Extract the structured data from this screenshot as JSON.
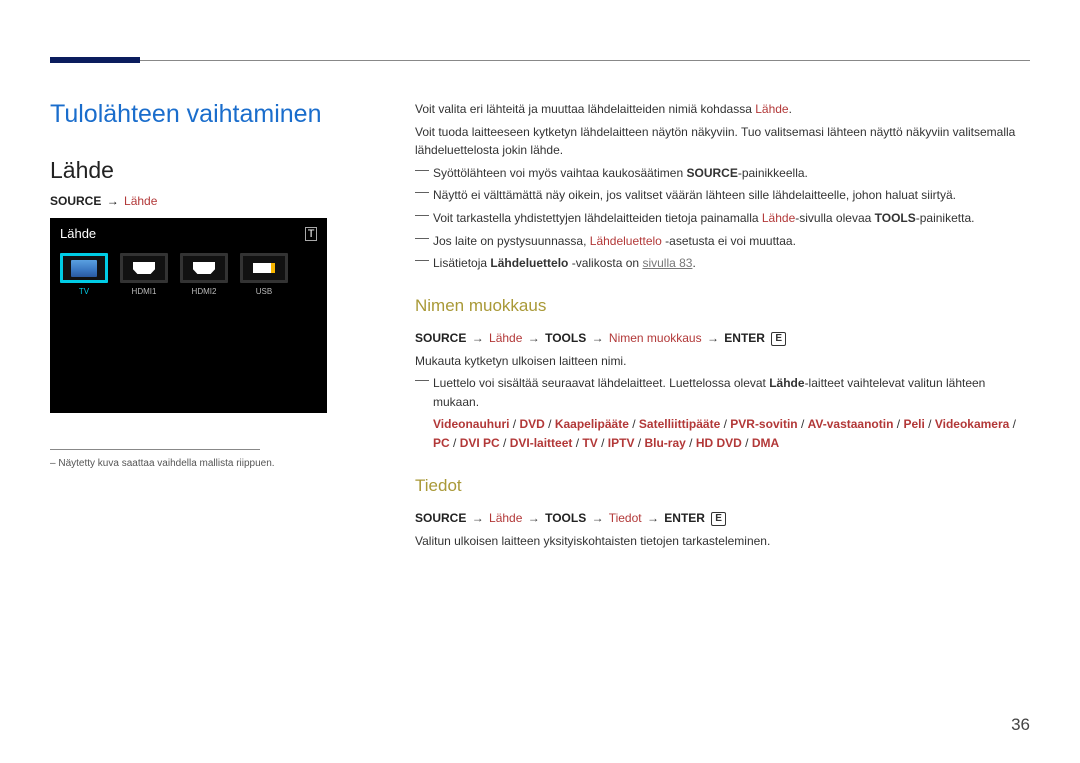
{
  "page_number": "36",
  "chapter_title": "Tulolähteen vaihtaminen",
  "section_title": "Lähde",
  "left_path": {
    "source": "SOURCE",
    "arrow": "→",
    "lahde": "Lähde"
  },
  "preview": {
    "title": "Lähde",
    "tool": "T",
    "items": [
      {
        "label": "TV",
        "selected": true,
        "kind": "tv"
      },
      {
        "label": "HDMI1",
        "selected": false,
        "kind": "hdmi"
      },
      {
        "label": "HDMI2",
        "selected": false,
        "kind": "hdmi"
      },
      {
        "label": "USB",
        "selected": false,
        "kind": "usb"
      }
    ]
  },
  "footnote_dash": "–",
  "footnote": "Näytetty kuva saattaa vaihdella mallista riippuen.",
  "right": {
    "intro1a": "Voit valita eri lähteitä ja muuttaa lähdelaitteiden nimiä kohdassa ",
    "intro1b": "Lähde",
    "intro1c": ".",
    "intro2": "Voit tuoda laitteeseen kytketyn lähdelaitteen näytön näkyviin. Tuo valitsemasi lähteen näyttö näkyviin valitsemalla lähdeluettelosta jokin lähde.",
    "bullets": [
      {
        "pre": "Syöttölähteen voi myös vaihtaa kaukosäätimen ",
        "bold": "SOURCE",
        "post": "-painikkeella."
      },
      {
        "pre": "Näyttö ei välttämättä näy oikein, jos valitset väärän lähteen sille lähdelaitteelle, johon haluat siirtyä."
      },
      {
        "pre": "Voit tarkastella yhdistettyjen lähdelaitteiden tietoja painamalla ",
        "red": "Lähde",
        "mid": "-sivulla olevaa ",
        "bold": "TOOLS",
        "post": "-painiketta."
      },
      {
        "pre": "Jos laite on pystysuunnassa, ",
        "red": "Lähdeluettelo",
        "post": " -asetusta ei voi muuttaa."
      },
      {
        "pre": "Lisätietoja ",
        "bold": "Lähdeluettelo",
        "mid2": " -valikosta on ",
        "link": "sivulla 83",
        "post": "."
      }
    ],
    "nimen": {
      "heading": "Nimen muokkaus",
      "path": {
        "source": "SOURCE",
        "arrow": "→",
        "lahde": "Lähde",
        "tools": "TOOLS",
        "nimen": "Nimen muokkaus",
        "enter": "ENTER",
        "btn": "E"
      },
      "p1": "Mukauta kytketyn ulkoisen laitteen nimi.",
      "sub_pre": "Luettelo voi sisältää seuraavat lähdelaitteet. Luettelossa olevat ",
      "sub_bold": "Lähde",
      "sub_post": "-laitteet vaihtelevat valitun lähteen mukaan.",
      "list": [
        "Videonauhuri",
        "DVD",
        "Kaapelipääte",
        "Satelliittipääte",
        "PVR-sovitin",
        "AV-vastaanotin",
        "Peli",
        "Videokamera",
        "PC",
        "DVI PC",
        "DVI-laitteet",
        "TV",
        "IPTV",
        "Blu-ray",
        "HD DVD",
        "DMA"
      ],
      "slash": " / "
    },
    "tiedot": {
      "heading": "Tiedot",
      "path": {
        "source": "SOURCE",
        "arrow": "→",
        "lahde": "Lähde",
        "tools": "TOOLS",
        "tiedot": "Tiedot",
        "enter": "ENTER",
        "btn": "E"
      },
      "p1": "Valitun ulkoisen laitteen yksityiskohtaisten tietojen tarkasteleminen."
    }
  },
  "dash_char": "―"
}
